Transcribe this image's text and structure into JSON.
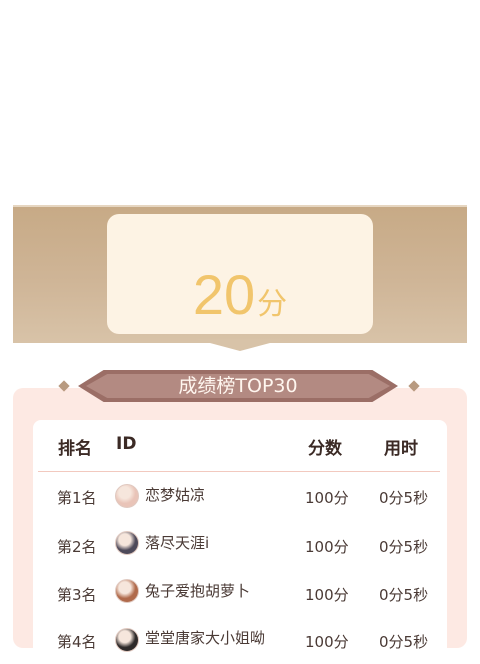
{
  "score": {
    "value": "20",
    "unit": "分"
  },
  "leaderboard": {
    "title": "成绩榜TOP30",
    "headers": {
      "rank": "排名",
      "id": "ID",
      "score": "分数",
      "time": "用时"
    },
    "rows": [
      {
        "rank": "第1名",
        "name": "恋梦姑凉",
        "score": "100分",
        "time": "0分5秒",
        "avatar_color": "#e9c4b8"
      },
      {
        "rank": "第2名",
        "name": "落尽天涯i",
        "score": "100分",
        "time": "0分5秒",
        "avatar_color": "#4e4a5a"
      },
      {
        "rank": "第3名",
        "name": "兔子爱抱胡萝卜",
        "score": "100分",
        "time": "0分5秒",
        "avatar_color": "#b06a4b"
      },
      {
        "rank": "第4名",
        "name": "堂堂唐家大小姐呦",
        "score": "100分",
        "time": "0分5秒",
        "avatar_color": "#2e2a2a"
      }
    ]
  }
}
